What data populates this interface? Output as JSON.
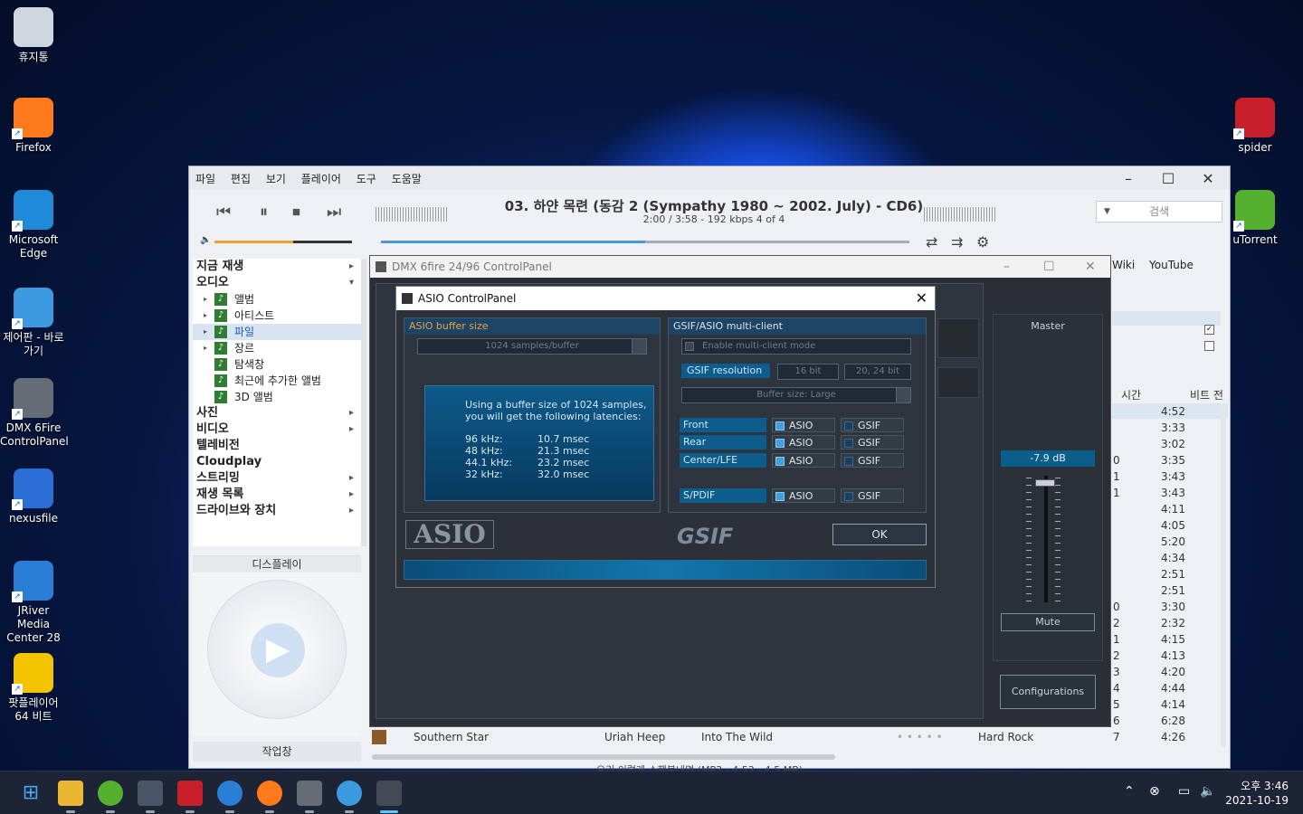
{
  "desktop": {
    "icons_left": [
      {
        "label": "휴지통",
        "icon": "recycle-bin-icon",
        "color": "#d0d6de"
      },
      {
        "label": "Firefox",
        "icon": "firefox-icon",
        "color": "#ff7a1a"
      },
      {
        "label": "Microsoft Edge",
        "icon": "edge-icon",
        "color": "#1f8ad8"
      },
      {
        "label": "제어판 - 바로 가기",
        "icon": "control-panel-icon",
        "color": "#3c9be0"
      },
      {
        "label": "DMX 6Fire ControlPanel",
        "icon": "dmx-icon",
        "color": "#666c75"
      },
      {
        "label": "nexusfile",
        "icon": "nexusfile-icon",
        "color": "#2a6fd6"
      },
      {
        "label": "JRiver Media Center 28",
        "icon": "jriver-icon",
        "color": "#2b7ed6"
      },
      {
        "label": "팟플레이어 64 비트",
        "icon": "potplayer-icon",
        "color": "#f5c400"
      }
    ],
    "icons_right": [
      {
        "label": "spider",
        "icon": "spider-icon",
        "color": "#c8202a"
      },
      {
        "label": "uTorrent",
        "icon": "utorrent-icon",
        "color": "#56b030"
      }
    ]
  },
  "jriver": {
    "menu": [
      "파일",
      "편집",
      "보기",
      "플레이어",
      "도구",
      "도움말"
    ],
    "track_title": "03. 하얀 목련 (동감 2 (Sympathy 1980 ~ 2002. July) - CD6)",
    "track_meta": "2:00 / 3:58 -   192 kbps   4 of 4",
    "search_placeholder": "검색",
    "volume": 0.57,
    "progress": 0.5,
    "sidebar": {
      "top": [
        {
          "label": "지금 재생",
          "chev": "▸"
        },
        {
          "label": "오디오",
          "chev": "▾"
        }
      ],
      "audio_sub": [
        {
          "label": "앨범"
        },
        {
          "label": "아티스트"
        },
        {
          "label": "파일"
        },
        {
          "label": "장르"
        },
        {
          "label": "탐색창"
        },
        {
          "label": "최근에 추가한 앨범"
        },
        {
          "label": "3D 앨범"
        }
      ],
      "bottom": [
        {
          "label": "사진",
          "chev": "▸"
        },
        {
          "label": "비디오",
          "chev": "▸"
        },
        {
          "label": "텔레비전",
          "chev": ""
        },
        {
          "label": "Cloudplay",
          "chev": ""
        },
        {
          "label": "스트리밍",
          "chev": "▸"
        },
        {
          "label": "재생 목록",
          "chev": "▸"
        },
        {
          "label": "드라이브와 장치",
          "chev": "▸"
        }
      ]
    },
    "display_label": "디스플레이",
    "workbar_label": "작업창",
    "right_tabs": [
      "Wiki",
      "YouTube"
    ],
    "time_header": "시간",
    "bitrate_header": "비트 전",
    "time_rows": [
      {
        "num": "",
        "time": "4:52"
      },
      {
        "num": "",
        "time": "3:33"
      },
      {
        "num": "",
        "time": "3:02"
      },
      {
        "num": "0",
        "time": "3:35"
      },
      {
        "num": "1",
        "time": "3:43"
      },
      {
        "num": "1",
        "time": "3:43"
      },
      {
        "num": "",
        "time": "4:11"
      },
      {
        "num": "",
        "time": "4:05"
      },
      {
        "num": "",
        "time": "5:20"
      },
      {
        "num": "",
        "time": "4:34"
      },
      {
        "num": "",
        "time": "2:51"
      },
      {
        "num": "",
        "time": "2:51"
      },
      {
        "num": "0",
        "time": "3:30"
      },
      {
        "num": "2",
        "time": "2:32"
      },
      {
        "num": "1",
        "time": "4:15"
      },
      {
        "num": "2",
        "time": "4:13"
      },
      {
        "num": "3",
        "time": "4:20"
      },
      {
        "num": "4",
        "time": "4:44"
      },
      {
        "num": "5",
        "time": "4:14"
      },
      {
        "num": "6",
        "time": "6:28"
      },
      {
        "num": "7",
        "time": "4:26"
      }
    ],
    "bottom_row": {
      "title": "Southern Star",
      "artist": "Uriah Heep",
      "album": "Into The Wild",
      "genre": "Hard Rock"
    },
    "status_text": "오리 이렇게 소행복내명 (MP3 - 4:53 - 4.5 MB)"
  },
  "dmx": {
    "title": "DMX 6fire 24/96 ControlPanel",
    "master_label": "Master",
    "db_value": "-7.9 dB",
    "mute_label": "Mute",
    "config_label": "Configurations"
  },
  "asio": {
    "title": "ASIO ControlPanel",
    "buffer_title": "ASIO buffer size",
    "buffer_value": "1024 samples/buffer",
    "info_text_1": "Using a buffer size of 1024 samples,",
    "info_text_2": "you will get the following latencies:",
    "latencies": [
      {
        "rate": "96 kHz:",
        "ms": "10.7 msec"
      },
      {
        "rate": "48 kHz:",
        "ms": "21.3 msec"
      },
      {
        "rate": "44.1 kHz:",
        "ms": "23.2 msec"
      },
      {
        "rate": "32 kHz:",
        "ms": "32.0 msec"
      }
    ],
    "gsif_title": "GSIF/ASIO multi-client",
    "multiclient_label": "Enable multi-client mode",
    "gsif_resolution": "GSIF resolution",
    "res_16": "16 bit",
    "res_20": "20, 24 bit",
    "gsif_buffer": "Buffer size: Large",
    "routes": [
      {
        "name": "Front",
        "asio": "ASIO",
        "gsif": "GSIF"
      },
      {
        "name": "Rear",
        "asio": "ASIO",
        "gsif": "GSIF"
      },
      {
        "name": "Center/LFE",
        "asio": "ASIO",
        "gsif": "GSIF"
      },
      {
        "name": "S/PDIF",
        "asio": "ASIO",
        "gsif": "GSIF"
      }
    ],
    "ok_label": "OK",
    "asio_logo": "ASIO",
    "gsif_logo": "GSIF"
  },
  "taskbar": {
    "time": "오후 3:46",
    "date": "2021-10-19"
  }
}
